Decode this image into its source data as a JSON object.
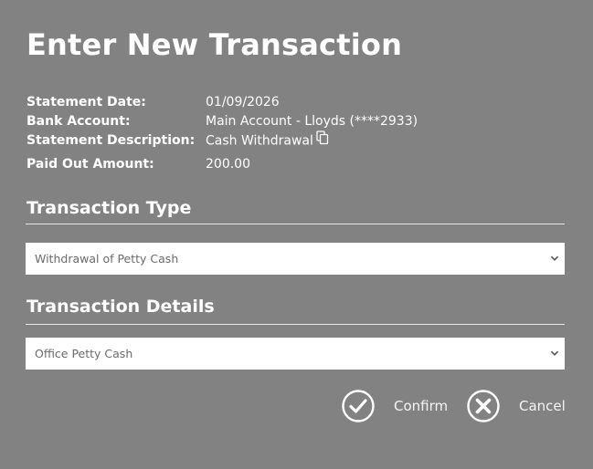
{
  "dialog": {
    "title": "Enter New Transaction"
  },
  "statement": {
    "date_label": "Statement Date:",
    "date_value": "01/09/2026",
    "account_label": "Bank Account:",
    "account_value": "Main Account - Lloyds (****2933)",
    "description_label": "Statement Description:",
    "description_value": "Cash Withdrawal",
    "amount_label": "Paid Out Amount:",
    "amount_value": "200.00"
  },
  "transaction_type": {
    "heading": "Transaction Type",
    "selected": "Withdrawal of Petty Cash"
  },
  "transaction_details": {
    "heading": "Transaction Details",
    "selected": "Office Petty Cash"
  },
  "actions": {
    "confirm_label": "Confirm",
    "cancel_label": "Cancel"
  },
  "colors": {
    "background": "#828282",
    "text": "#ffffff",
    "select_background": "#ffffff",
    "select_text": "#6b6b6b"
  },
  "icons": {
    "copy": "copy-icon",
    "confirm": "check-circle-icon",
    "cancel": "x-circle-icon",
    "dropdown": "chevron-down-icon"
  }
}
